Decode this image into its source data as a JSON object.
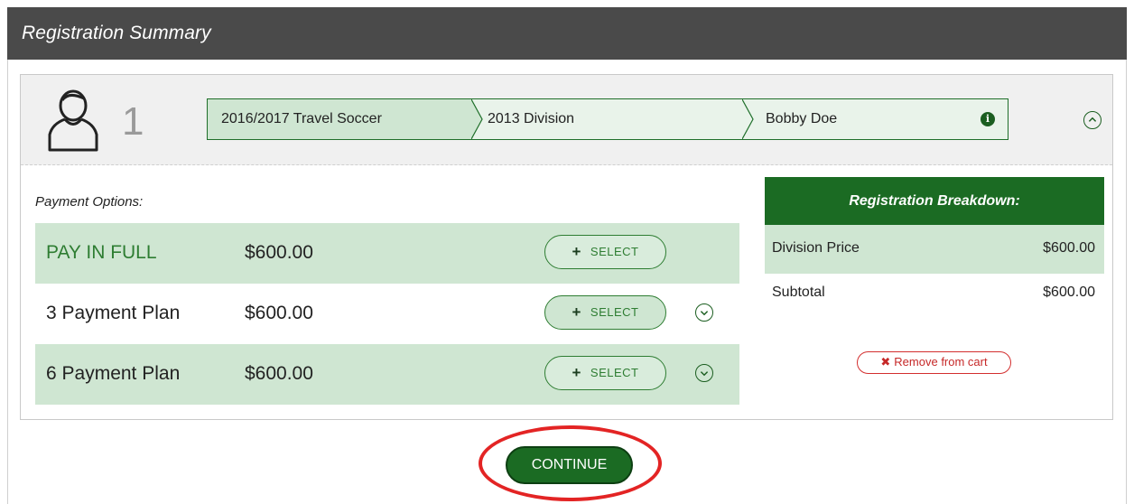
{
  "header": {
    "title": "Registration Summary"
  },
  "registration": {
    "number": "1",
    "breadcrumb": [
      "2016/2017 Travel Soccer",
      "2013 Division",
      "Bobby Doe"
    ],
    "info_icon": "i"
  },
  "payment": {
    "label": "Payment Options:",
    "select_label": "SELECT",
    "plus_glyph": "+",
    "rows": [
      {
        "name": "PAY IN FULL",
        "price": "$600.00"
      },
      {
        "name": "3 Payment Plan",
        "price": "$600.00"
      },
      {
        "name": "6 Payment Plan",
        "price": "$600.00"
      }
    ]
  },
  "breakdown": {
    "title": "Registration Breakdown:",
    "rows": [
      {
        "label": "Division Price",
        "value": "$600.00"
      },
      {
        "label": "Subtotal",
        "value": "$600.00"
      }
    ],
    "remove_glyph": "✖",
    "remove_label": "Remove from cart"
  },
  "actions": {
    "continue_label": "CONTINUE"
  },
  "colors": {
    "title_bar": "#4a4a4a",
    "accent_green": "#1b6b23",
    "light_green": "#cfe6d2",
    "remove_red": "#d32f2f",
    "highlight_red": "#e32424"
  }
}
